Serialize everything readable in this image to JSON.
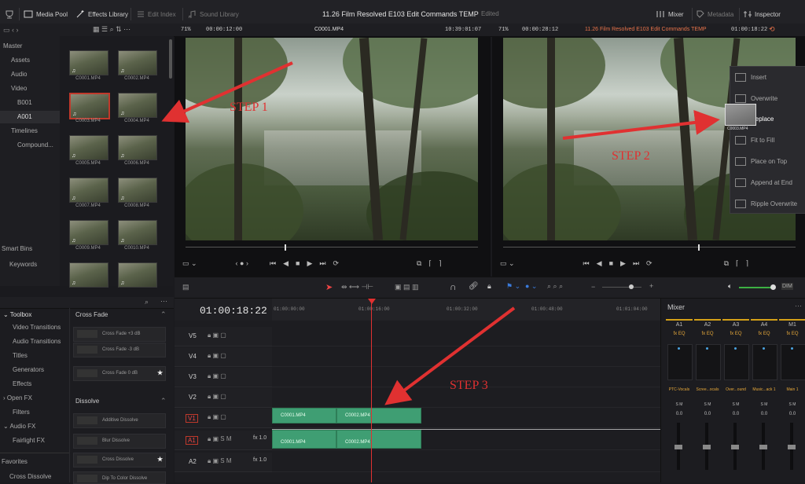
{
  "topbar": {
    "media_pool": "Media Pool",
    "effects_library": "Effects Library",
    "edit_index": "Edit Index",
    "sound_library": "Sound Library",
    "project_title": "11.26 Film Resolved E103 Edit Commands TEMP",
    "edited": "Edited",
    "mixer": "Mixer",
    "metadata": "Metadata",
    "inspector": "Inspector"
  },
  "source_viewer": {
    "zoom": "71%",
    "timecode": "00:00:12:00",
    "clip": "C0001.MP4",
    "tc_right": "10:39:01:07"
  },
  "timeline_viewer": {
    "zoom": "71%",
    "timecode": "00:00:28:12",
    "title": "11.26 Film Resolved E103 Edit Commands TEMP",
    "tc_right": "01:00:18:22"
  },
  "bins": {
    "items": [
      "Master",
      "Assets",
      "Audio",
      "Video",
      "B001",
      "A001",
      "Timelines",
      "Compound..."
    ],
    "smart_bins": "Smart Bins",
    "keywords": "Keywords"
  },
  "media": [
    "C0001.MP4",
    "C0002.MP4",
    "C0003.MP4",
    "C0004.MP4",
    "C0005.MP4",
    "C0006.MP4",
    "C0007.MP4",
    "C0008.MP4",
    "C0009.MP4",
    "C0010.MP4",
    "",
    ""
  ],
  "annotations": {
    "step1": "STEP 1",
    "step2": "STEP 2",
    "step3": "STEP 3"
  },
  "overlay_menu": {
    "items": [
      "Insert",
      "Overwrite",
      "Replace",
      "Fit to Fill",
      "Place on Top",
      "Append at End",
      "Ripple Overwrite"
    ],
    "drag_clip": "C0003.MP4"
  },
  "toolbox": {
    "title": "Toolbox",
    "items": [
      "Video Transitions",
      "Audio Transitions",
      "Titles",
      "Generators",
      "Effects"
    ],
    "open_fx": "Open FX",
    "filters": "Filters",
    "audio_fx": "Audio FX",
    "fairlight_fx": "Fairlight FX",
    "favorites": "Favorites",
    "fav_item": "Cross Dissolve"
  },
  "transitions": {
    "cross_fade": "Cross Fade",
    "cross_fade_items": [
      "Cross Fade +3 dB",
      "Cross Fade -3 dB",
      "Cross Fade 0 dB"
    ],
    "dissolve": "Dissolve",
    "dissolve_items": [
      "Additive Dissolve",
      "Blur Dissolve",
      "Cross Dissolve",
      "Dip To Color Dissolve"
    ]
  },
  "timeline": {
    "timecode": "01:00:18:22",
    "ruler": [
      "01:00:00:00",
      "01:00:16:00",
      "01:00:32:00",
      "01:00:48:00",
      "01:01:04:00"
    ],
    "tracks": [
      "V5",
      "V4",
      "V3",
      "V2",
      "V1",
      "A1",
      "A2"
    ],
    "audio_level": "1.0",
    "clips": {
      "v1a": "C0001.MP4",
      "v1b": "C0002.MP4",
      "a1a": "C0001.MP4",
      "a1b": "C0002.MP4"
    }
  },
  "mixer": {
    "title": "Mixer",
    "channels": [
      "A1",
      "A2",
      "A3",
      "A4",
      "M1"
    ],
    "names": [
      "PTC-Vocals",
      "Scree...ocals",
      "Over...ound",
      "Music...ack 1",
      "Main 1"
    ],
    "value": "0.0",
    "accent": "#d4a017"
  }
}
